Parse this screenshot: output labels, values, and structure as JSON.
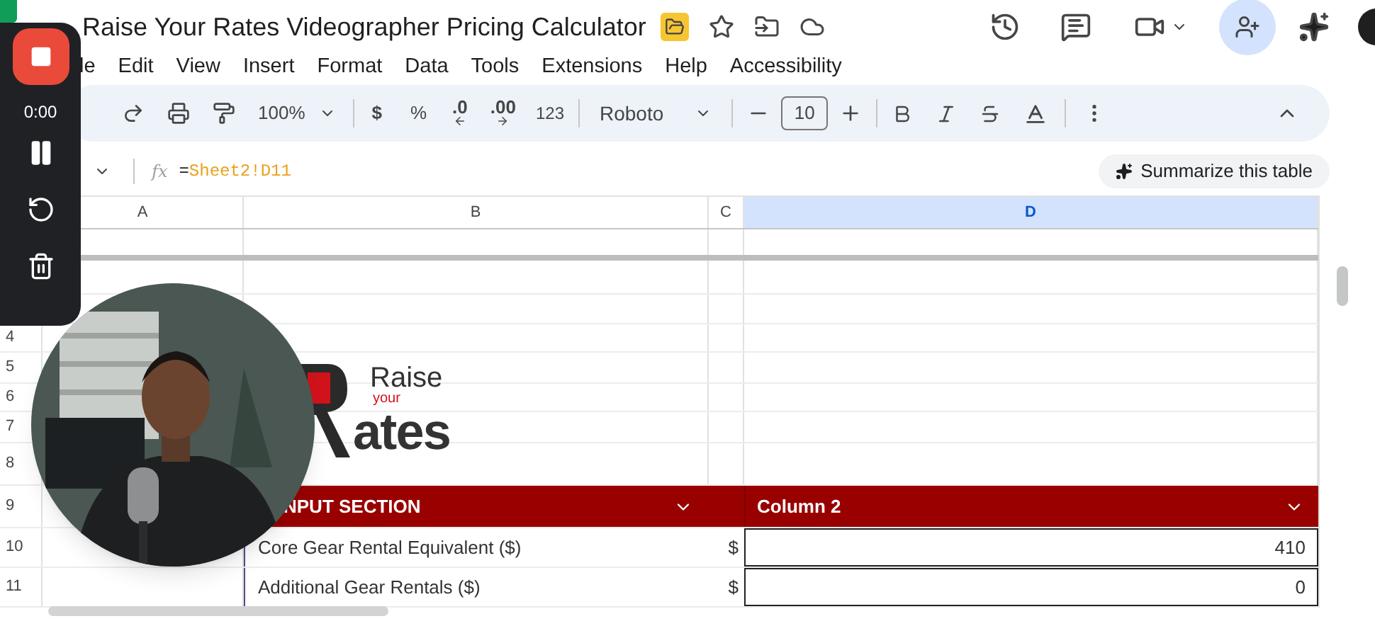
{
  "document": {
    "title": "Raise Your Rates Videographer Pricing Calculator"
  },
  "menu": [
    "le",
    "Edit",
    "View",
    "Insert",
    "Format",
    "Data",
    "Tools",
    "Extensions",
    "Help",
    "Accessibility"
  ],
  "toolbar": {
    "zoom": "100%",
    "currency": "$",
    "percent": "%",
    "decrease_decimals": ".0",
    "increase_decimals": ".00",
    "number_format": "123",
    "font": "Roboto",
    "font_size": "10"
  },
  "formula_bar": {
    "fx": "fx",
    "operator": "=",
    "reference": "Sheet2!D11",
    "summarize_button": "Summarize this table"
  },
  "columns": [
    {
      "label": "A",
      "selected": false
    },
    {
      "label": "B",
      "selected": false
    },
    {
      "label": "C",
      "selected": false
    },
    {
      "label": "D",
      "selected": true
    }
  ],
  "row_numbers": [
    "4",
    "5",
    "6",
    "7",
    "8",
    "9",
    "10",
    "11"
  ],
  "logo": {
    "line_1": "Raise",
    "line_2": "your",
    "line_3": "ates"
  },
  "table_header": [
    "NPUT SECTION",
    "Column 2"
  ],
  "table_rows": [
    {
      "label": "Core Gear Rental Equivalent ($)",
      "currency": "$",
      "value": "410"
    },
    {
      "label": "Additional Gear Rentals ($)",
      "currency": "$",
      "value": "0"
    }
  ],
  "recorder": {
    "timer": "0:00"
  }
}
